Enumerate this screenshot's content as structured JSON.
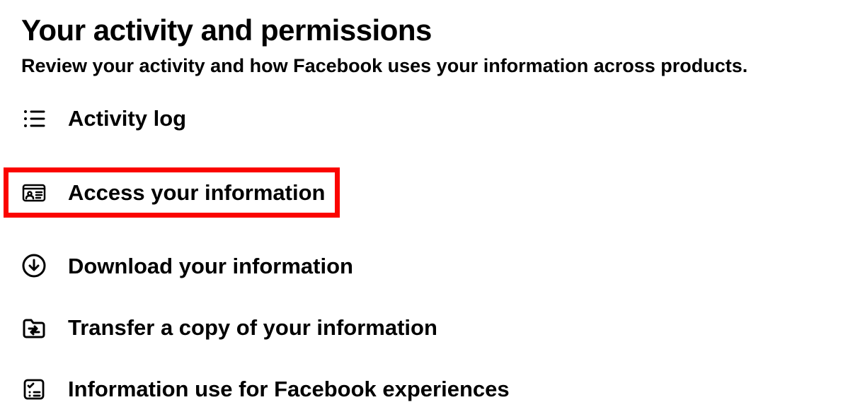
{
  "header": {
    "title": "Your activity and permissions",
    "subtitle": "Review your activity and how Facebook uses your information across products."
  },
  "menu": {
    "items": [
      {
        "label": "Activity log",
        "icon": "activity-log"
      },
      {
        "label": "Access your information",
        "icon": "id-card",
        "highlighted": true
      },
      {
        "label": "Download your information",
        "icon": "download-circle"
      },
      {
        "label": "Transfer a copy of your information",
        "icon": "folder-transfer"
      },
      {
        "label": "Information use for Facebook experiences",
        "icon": "checklist"
      }
    ]
  },
  "highlight_color": "#fb0400"
}
